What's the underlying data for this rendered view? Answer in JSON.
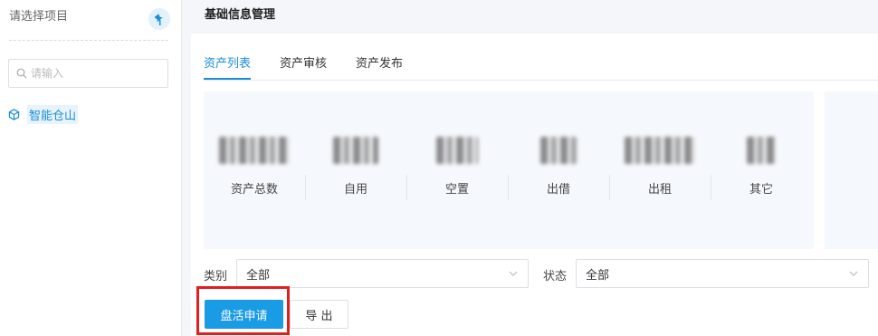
{
  "sidebar": {
    "title": "请选择项目",
    "search_placeholder": "请输入",
    "tree_items": [
      {
        "label": "智能仓山"
      }
    ]
  },
  "page_title": "基础信息管理",
  "tabs": [
    {
      "label": "资产列表",
      "active": true
    },
    {
      "label": "资产审核",
      "active": false
    },
    {
      "label": "资产发布",
      "active": false
    }
  ],
  "stats": [
    {
      "label": "资产总数"
    },
    {
      "label": "自用"
    },
    {
      "label": "空置"
    },
    {
      "label": "出借"
    },
    {
      "label": "出租"
    },
    {
      "label": "其它"
    }
  ],
  "filters": {
    "category": {
      "label": "类别",
      "value": "全部"
    },
    "status": {
      "label": "状态",
      "value": "全部"
    }
  },
  "actions": {
    "apply_label": "盘活申请",
    "export_label": "导 出"
  },
  "colors": {
    "accent": "#1a8fd8",
    "button": "#1a9be6",
    "highlight": "#e02020"
  }
}
